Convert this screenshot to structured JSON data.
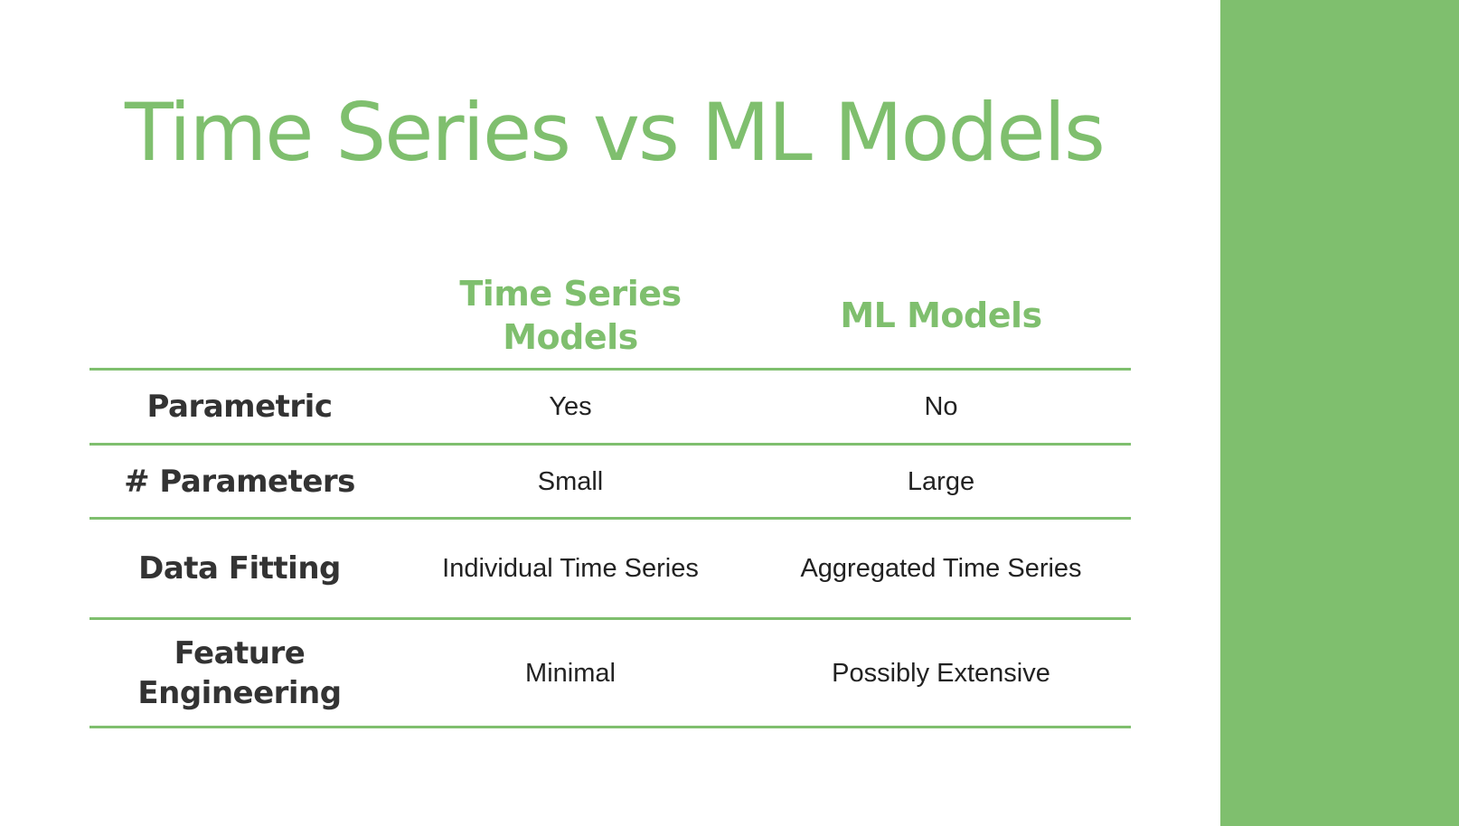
{
  "colors": {
    "accent": "#7fbf6e",
    "text": "#222222",
    "label": "#333333",
    "background": "#ffffff"
  },
  "slide": {
    "title": "Time Series vs ML Models"
  },
  "table": {
    "columns": [
      "Time Series Models",
      "ML Models"
    ],
    "rows": [
      {
        "label": "Parametric",
        "values": [
          "Yes",
          "No"
        ]
      },
      {
        "label": "# Parameters",
        "values": [
          "Small",
          "Large"
        ]
      },
      {
        "label": "Data Fitting",
        "values": [
          "Individual Time Series",
          "Aggregated Time Series"
        ]
      },
      {
        "label": "Feature Engineering",
        "values": [
          "Minimal",
          "Possibly Extensive"
        ]
      }
    ]
  }
}
